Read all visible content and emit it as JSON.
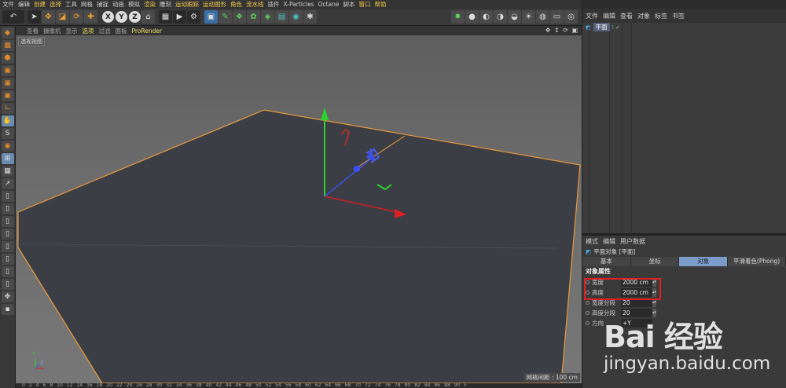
{
  "menubar": {
    "items": [
      {
        "label": "文件",
        "hl": false
      },
      {
        "label": "编辑",
        "hl": false
      },
      {
        "label": "创建",
        "hl": true
      },
      {
        "label": "选择",
        "hl": true
      },
      {
        "label": "工具",
        "hl": false
      },
      {
        "label": "网格",
        "hl": false
      },
      {
        "label": "捕捉",
        "hl": false
      },
      {
        "label": "动画",
        "hl": false
      },
      {
        "label": "模拟",
        "hl": false
      },
      {
        "label": "渲染",
        "hl": true
      },
      {
        "label": "雕刻",
        "hl": false
      },
      {
        "label": "运动跟踪",
        "hl": true
      },
      {
        "label": "运动图形",
        "hl": true
      },
      {
        "label": "角色",
        "hl": true
      },
      {
        "label": "流水线",
        "hl": true
      },
      {
        "label": "插件",
        "hl": false
      },
      {
        "label": "X-Particles",
        "hl": false
      },
      {
        "label": "Octane",
        "hl": false
      },
      {
        "label": "脚本",
        "hl": false
      },
      {
        "label": "窗口",
        "hl": true
      },
      {
        "label": "帮助",
        "hl": true
      }
    ]
  },
  "toolbar": {
    "undo_icon": "undo-icon",
    "axis_x": "X",
    "axis_y": "Y",
    "axis_z": "Z"
  },
  "viewport_header": {
    "items": [
      {
        "label": "查看",
        "hl": false
      },
      {
        "label": "摄像机",
        "hl": false
      },
      {
        "label": "显示",
        "hl": false
      },
      {
        "label": "选项",
        "hl": true
      },
      {
        "label": "过滤",
        "hl": false
      },
      {
        "label": "面板",
        "hl": false
      },
      {
        "label": "ProRender",
        "hl": true
      }
    ],
    "controls": "✥ ↕ ⟳ ▣"
  },
  "viewport": {
    "label": "透视视图",
    "grid_readout": "网格间距 : 100 cm",
    "mini_axis_y": "Y",
    "mini_axis_z": "Z"
  },
  "timeline": {
    "ticks": [
      "0",
      "2",
      "4",
      "6",
      "8",
      "10",
      "12",
      "14",
      "16",
      "18",
      "20",
      "22",
      "24",
      "26",
      "28",
      "30",
      "32",
      "34",
      "36",
      "38",
      "40",
      "42",
      "44",
      "46",
      "48",
      "50",
      "52",
      "54",
      "56",
      "58",
      "60",
      "62",
      "64",
      "66",
      "68",
      "70",
      "72",
      "74",
      "76",
      "78",
      "80",
      "82",
      "84",
      "86",
      "88",
      "90",
      "F"
    ]
  },
  "object_manager": {
    "menu": [
      "文件",
      "编辑",
      "查看",
      "对象",
      "标签",
      "书签"
    ],
    "objects": [
      {
        "name": "平面"
      }
    ]
  },
  "attribute_manager": {
    "menu": [
      "模式",
      "编辑",
      "用户数据"
    ],
    "mode_label": "平面对象 [平面]",
    "tabs": [
      {
        "label": "基本",
        "active": false
      },
      {
        "label": "坐标",
        "active": false
      },
      {
        "label": "对象",
        "active": true
      },
      {
        "label": "平滑着色(Phong)",
        "active": false
      }
    ],
    "section": "对象属性",
    "props": [
      {
        "label": "宽度",
        "value": "2000 cm"
      },
      {
        "label": "高度",
        "value": "2000 cm"
      },
      {
        "label": "宽度分段",
        "value": "20"
      },
      {
        "label": "高度分段",
        "value": "20"
      },
      {
        "label": "方向",
        "value": "+Y"
      }
    ]
  },
  "watermark": {
    "logo": "Bai 经验",
    "url": "jingyan.baidu.com"
  },
  "colors": {
    "accent": "#7b9cc9",
    "plane_edge": "#e89a3c",
    "plane_fill": "#3b3e44",
    "highlight_red": "#e02020"
  }
}
